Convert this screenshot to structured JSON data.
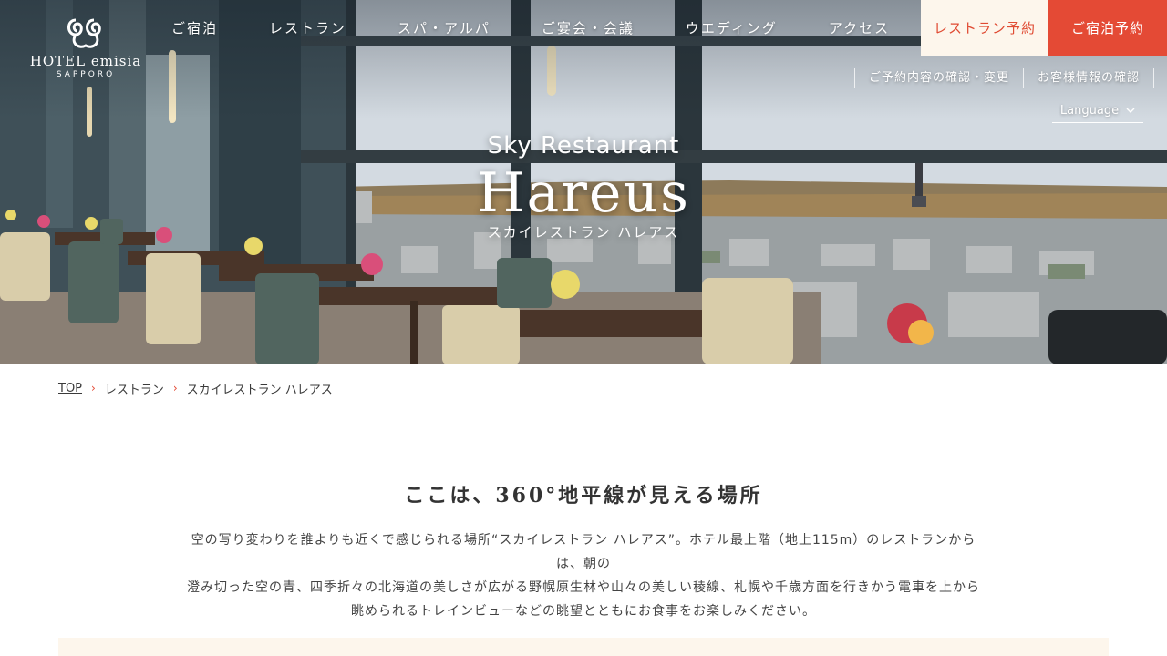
{
  "header": {
    "logo": {
      "name": "HOTEL emisia",
      "sub": "SAPPORO"
    },
    "nav": [
      {
        "label": "ご宿泊"
      },
      {
        "label": "レストラン"
      },
      {
        "label": "スパ・アルパ"
      },
      {
        "label": "ご宴会・会議"
      },
      {
        "label": "ウエディング"
      },
      {
        "label": "アクセス"
      }
    ],
    "reserve_restaurant": "レストラン予約",
    "reserve_stay": "ご宿泊予約",
    "subnav": [
      {
        "label": "ご予約内容の確認・変更"
      },
      {
        "label": "お客様情報の確認"
      }
    ],
    "language": "Language"
  },
  "hero": {
    "title_small": "Sky Restaurant",
    "title_big": "Hareus",
    "title_kana": "スカイレストラン ハレアス"
  },
  "breadcrumb": {
    "items": [
      {
        "label": "TOP"
      },
      {
        "label": "レストラン"
      }
    ],
    "current": "スカイレストラン ハレアス"
  },
  "intro": {
    "heading": "ここは、360°地平線が見える場所",
    "lines": [
      "空の写り変わりを誰よりも近くで感じられる場所“スカイレストラン ハレアス”。ホテル最上階（地上115m）のレストランからは、朝の",
      "澄み切った空の青、四季折々の北海道の美しさが広がる野幌原生林や山々の美しい稜線、札幌や千歳方面を行きかう電車を上から",
      "眺められるトレインビューなどの眺望とともにお食事をお楽しみください。"
    ]
  },
  "colors": {
    "accent": "#e44a35",
    "cream": "#fdf6ec",
    "text": "#3a3a3a"
  }
}
